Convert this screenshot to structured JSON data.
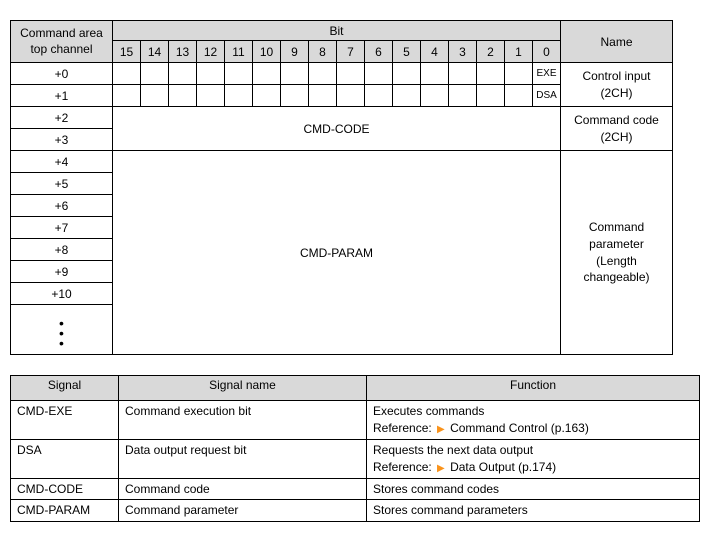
{
  "bitTable": {
    "hdrTopChannel1": "Command area",
    "hdrTopChannel2": "top channel",
    "hdrBitSuper": "Bit",
    "hdrBits": [
      "15",
      "14",
      "13",
      "12",
      "11",
      "10",
      "9",
      "8",
      "7",
      "6",
      "5",
      "4",
      "3",
      "2",
      "1",
      "0"
    ],
    "hdrName": "Name",
    "rows": {
      "r0": "+0",
      "r1": "+1",
      "r2": "+2",
      "r3": "+3",
      "r4": "+4",
      "r5": "+5",
      "r6": "+6",
      "r7": "+7",
      "r8": "+8",
      "r9": "+9",
      "r10": "+10"
    },
    "exeLabel": "EXE",
    "dsaLabel": "DSA",
    "cmdCodeLabel": "CMD-CODE",
    "cmdParamLabel": "CMD-PARAM",
    "nameControl1": "Control input",
    "nameControl2": "(2CH)",
    "nameCode1": "Command code",
    "nameCode2": "(2CH)",
    "nameParam1": "Command",
    "nameParam2": "parameter",
    "nameParam3": "(Length",
    "nameParam4": "changeable)"
  },
  "sigTable": {
    "hdrSignal": "Signal",
    "hdrSigName": "Signal name",
    "hdrFunction": "Function",
    "rows": [
      {
        "signal": "CMD-EXE",
        "name": "Command execution bit",
        "func1": "Executes commands",
        "refLabel": "Reference:",
        "refText": "Command Control (p.163)"
      },
      {
        "signal": "DSA",
        "name": "Data output request bit",
        "func1": "Requests the next data output",
        "refLabel": "Reference:",
        "refText": "Data Output (p.174)"
      },
      {
        "signal": "CMD-CODE",
        "name": "Command code",
        "func1": "Stores command codes"
      },
      {
        "signal": "CMD-PARAM",
        "name": "Command parameter",
        "func1": "Stores command parameters"
      }
    ]
  }
}
